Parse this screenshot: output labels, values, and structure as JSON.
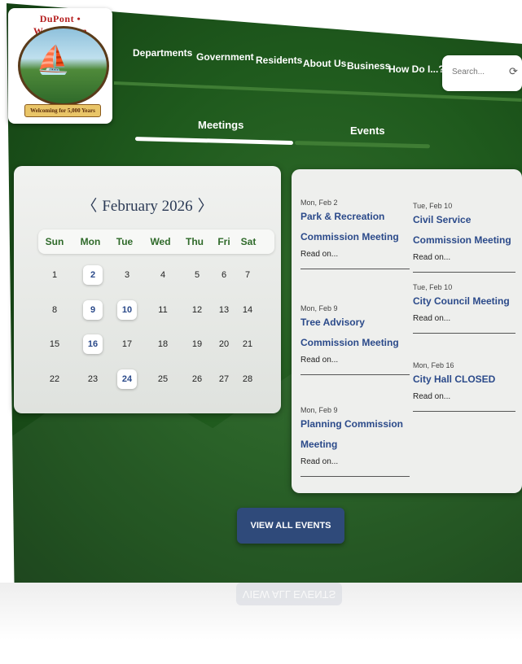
{
  "logo": {
    "name": "DuPont • Washington",
    "tagline": "Welcoming for 5,000 Years"
  },
  "nav": {
    "items": [
      {
        "label": "Departments"
      },
      {
        "label": "Government"
      },
      {
        "label": "Residents"
      },
      {
        "label": "About Us"
      },
      {
        "label": "Business"
      },
      {
        "label": "How Do I...?"
      }
    ]
  },
  "search": {
    "placeholder": "Search..."
  },
  "tabs": [
    {
      "label": "Meetings",
      "active": true
    },
    {
      "label": "Events",
      "active": false
    }
  ],
  "calendar": {
    "prev": "〈",
    "month": "February 2026",
    "next": "〉",
    "days_of_week": [
      "Sun",
      "Mon",
      "Tue",
      "Wed",
      "Thu",
      "Fri",
      "Sat"
    ],
    "weeks": [
      [
        "1",
        "2",
        "3",
        "4",
        "5",
        "6",
        "7"
      ],
      [
        "8",
        "9",
        "10",
        "11",
        "12",
        "13",
        "14"
      ],
      [
        "15",
        "16",
        "17",
        "18",
        "19",
        "20",
        "21"
      ],
      [
        "22",
        "23",
        "24",
        "25",
        "26",
        "27",
        "28"
      ]
    ],
    "event_days": [
      "2",
      "9",
      "10",
      "16",
      "24"
    ]
  },
  "events": {
    "left": [
      {
        "date": "Mon, Feb 2",
        "title": "Park & Recreation Commission Meeting",
        "read": "Read on..."
      },
      {
        "date": "Mon, Feb 9",
        "title": "Tree Advisory Commission Meeting",
        "read": "Read on..."
      },
      {
        "date": "Mon, Feb 9",
        "title": "Planning Commission Meeting",
        "read": "Read on..."
      }
    ],
    "right": [
      {
        "date": "Tue, Feb 10",
        "title": "Civil Service Commission Meeting",
        "read": "Read on..."
      },
      {
        "date": "Tue, Feb 10",
        "title": "City Council Meeting",
        "read": "Read on..."
      },
      {
        "date": "Mon, Feb 16",
        "title": "City Hall CLOSED",
        "read": "Read on..."
      }
    ]
  },
  "view_all": {
    "label": "VIEW ALL EVENTS"
  },
  "colors": {
    "background_green": "#1f5a1d",
    "accent_blue": "#2b4a8a",
    "button_blue": "#2f4a7a",
    "highlight_green": "#2f6a2a"
  }
}
